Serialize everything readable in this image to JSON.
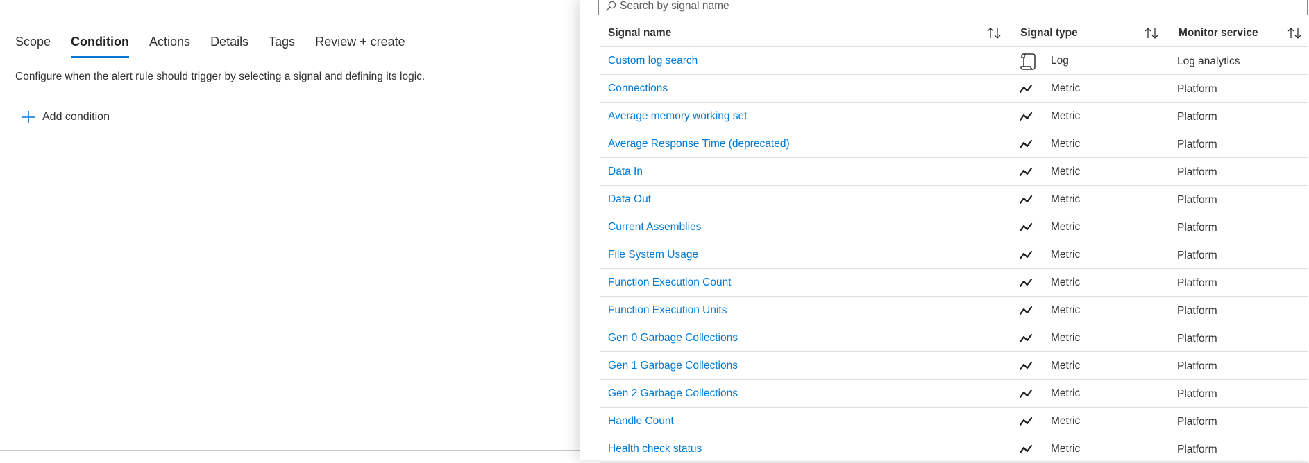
{
  "tabs": [
    "Scope",
    "Condition",
    "Actions",
    "Details",
    "Tags",
    "Review + create"
  ],
  "active_tab": "Condition",
  "description": "Configure when the alert rule should trigger by selecting a signal and defining its logic.",
  "add_condition_label": "Add condition",
  "search": {
    "placeholder": "Search by signal name",
    "value": ""
  },
  "columns": {
    "name": "Signal name",
    "type": "Signal type",
    "service": "Monitor service"
  },
  "accent_color": "#0078d4",
  "rows": [
    {
      "name": "Custom log search",
      "type": "Log",
      "icon": "log-icon",
      "service": "Log analytics"
    },
    {
      "name": "Connections",
      "type": "Metric",
      "icon": "metric-icon",
      "service": "Platform"
    },
    {
      "name": "Average memory working set",
      "type": "Metric",
      "icon": "metric-icon",
      "service": "Platform"
    },
    {
      "name": "Average Response Time (deprecated)",
      "type": "Metric",
      "icon": "metric-icon",
      "service": "Platform"
    },
    {
      "name": "Data In",
      "type": "Metric",
      "icon": "metric-icon",
      "service": "Platform"
    },
    {
      "name": "Data Out",
      "type": "Metric",
      "icon": "metric-icon",
      "service": "Platform"
    },
    {
      "name": "Current Assemblies",
      "type": "Metric",
      "icon": "metric-icon",
      "service": "Platform"
    },
    {
      "name": "File System Usage",
      "type": "Metric",
      "icon": "metric-icon",
      "service": "Platform"
    },
    {
      "name": "Function Execution Count",
      "type": "Metric",
      "icon": "metric-icon",
      "service": "Platform"
    },
    {
      "name": "Function Execution Units",
      "type": "Metric",
      "icon": "metric-icon",
      "service": "Platform"
    },
    {
      "name": "Gen 0 Garbage Collections",
      "type": "Metric",
      "icon": "metric-icon",
      "service": "Platform"
    },
    {
      "name": "Gen 1 Garbage Collections",
      "type": "Metric",
      "icon": "metric-icon",
      "service": "Platform"
    },
    {
      "name": "Gen 2 Garbage Collections",
      "type": "Metric",
      "icon": "metric-icon",
      "service": "Platform"
    },
    {
      "name": "Handle Count",
      "type": "Metric",
      "icon": "metric-icon",
      "service": "Platform"
    },
    {
      "name": "Health check status",
      "type": "Metric",
      "icon": "metric-icon",
      "service": "Platform"
    }
  ]
}
